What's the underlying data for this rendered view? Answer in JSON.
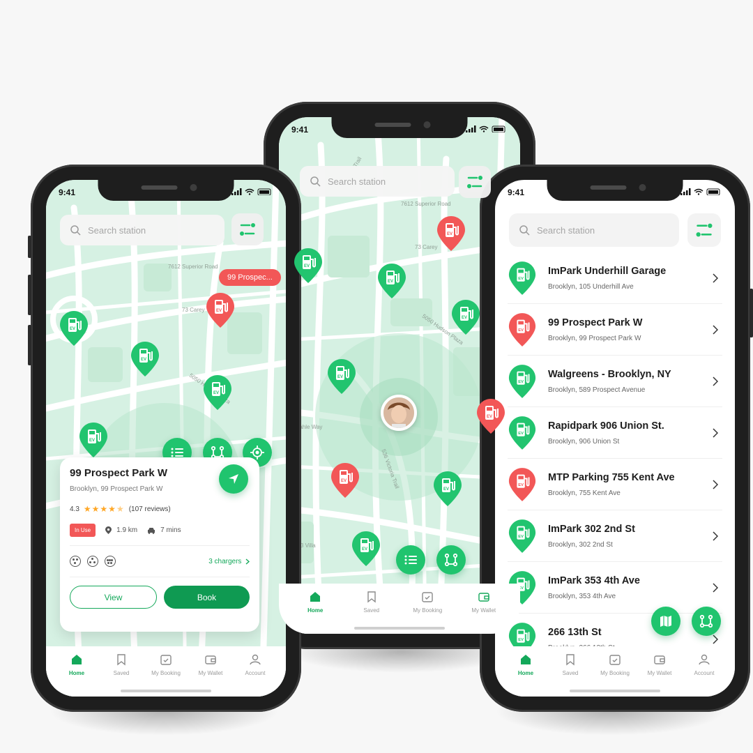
{
  "status": {
    "time": "9:41"
  },
  "search": {
    "placeholder": "Search station"
  },
  "tabs": [
    {
      "label": "Home",
      "icon": "home-icon"
    },
    {
      "label": "Saved",
      "icon": "bookmark-icon"
    },
    {
      "label": "My Booking",
      "icon": "calendar-check-icon"
    },
    {
      "label": "My Wallet",
      "icon": "wallet-icon"
    },
    {
      "label": "Account",
      "icon": "user-icon"
    }
  ],
  "map": {
    "streets": [
      "7612 Superior Road",
      "73 Carey",
      "5050 Hudson Plaza",
      "967 Dahle Way",
      "536 Victoria Trail",
      "813 Villa",
      "Trail"
    ],
    "selected_tag": "99 Prospec..."
  },
  "card": {
    "title": "99 Prospect Park W",
    "address": "Brooklyn, 99 Prospect Park W",
    "rating": "4.3",
    "reviews": "(107 reviews)",
    "status_badge": "In Use",
    "distance": "1.9 km",
    "duration": "7 mins",
    "chargers": "3 chargers",
    "view_label": "View",
    "book_label": "Book"
  },
  "stations": [
    {
      "name": "ImPark Underhill Garage",
      "address": "Brooklyn, 105 Underhill Ave",
      "status": "available"
    },
    {
      "name": "99 Prospect Park W",
      "address": "Brooklyn, 99 Prospect Park W",
      "status": "in-use"
    },
    {
      "name": "Walgreens - Brooklyn, NY",
      "address": "Brooklyn, 589 Prospect Avenue",
      "status": "available"
    },
    {
      "name": "Rapidpark 906 Union St.",
      "address": "Brooklyn, 906 Union St",
      "status": "available"
    },
    {
      "name": "MTP Parking 755 Kent Ave",
      "address": "Brooklyn, 755 Kent Ave",
      "status": "in-use"
    },
    {
      "name": "ImPark 302 2nd St",
      "address": "Brooklyn, 302 2nd St",
      "status": "available"
    },
    {
      "name": "ImPark 353 4th Ave",
      "address": "Brooklyn, 353 4th Ave",
      "status": "available"
    },
    {
      "name": "266 13th St",
      "address": "Brooklyn, 266 13th St",
      "status": "available"
    }
  ],
  "colors": {
    "accent": "#20c46e",
    "accent_dark": "#0f9a52",
    "in_use": "#f25757",
    "map_bg": "#d6f1e3"
  }
}
